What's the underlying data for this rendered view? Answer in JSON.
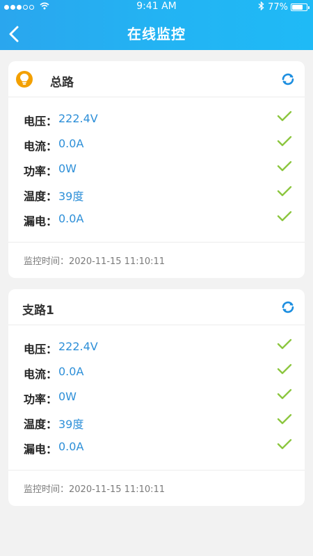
{
  "status_bar": {
    "time": "9:41 AM",
    "battery": "77%",
    "battery_level": 0.77
  },
  "header": {
    "title": "在线监控"
  },
  "colors": {
    "accent": "#1fa6ef",
    "value_text": "#2d8fd8",
    "check": "#8cc63f",
    "bulb": "#f3a000"
  },
  "cards": [
    {
      "title": "总路",
      "icon": "lightbulb-icon",
      "rows": [
        {
          "label": "电压：",
          "value": "222.4V"
        },
        {
          "label": "电流：",
          "value": "0.0A"
        },
        {
          "label": "功率：",
          "value": "0W"
        },
        {
          "label": "温度：",
          "value": "39度"
        },
        {
          "label": "漏电：",
          "value": "0.0A"
        }
      ],
      "footer": "监控时间：2020-11-15    11:10:11"
    },
    {
      "title": "支路1",
      "rows": [
        {
          "label": "电压：",
          "value": "222.4V"
        },
        {
          "label": "电流：",
          "value": "0.0A"
        },
        {
          "label": "功率：",
          "value": "0W"
        },
        {
          "label": "温度：",
          "value": "39度"
        },
        {
          "label": "漏电：",
          "value": "0.0A"
        }
      ],
      "footer": "监控时间：2020-11-15    11:10:11"
    }
  ]
}
